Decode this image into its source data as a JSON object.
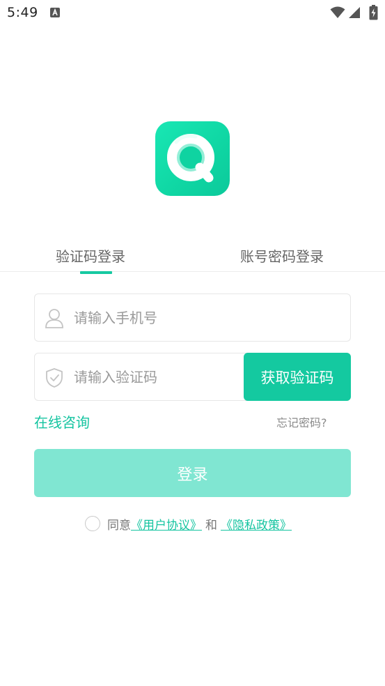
{
  "status_bar": {
    "time": "5:49",
    "notification_icon": "a-notification-icon",
    "wifi_icon": "wifi-icon",
    "signal_icon": "cellular-signal-icon",
    "battery_icon": "battery-charging-icon"
  },
  "logo": {
    "icon": "app-logo-q"
  },
  "tabs": [
    {
      "label": "验证码登录",
      "active": true
    },
    {
      "label": "账号密码登录",
      "active": false
    }
  ],
  "phone_field": {
    "placeholder": "请输入手机号",
    "icon": "user-icon"
  },
  "code_field": {
    "placeholder": "请输入验证码",
    "icon": "shield-check-icon"
  },
  "get_code_button": {
    "label": "获取验证码"
  },
  "consult_link": {
    "label": "在线咨询"
  },
  "forgot_link": {
    "label": "忘记密码?"
  },
  "login_button": {
    "label": "登录"
  },
  "agreement": {
    "prefix": "同意",
    "user_agreement": "《用户协议》",
    "and": "和",
    "privacy_policy": "《隐私政策》",
    "checked": false
  },
  "colors": {
    "accent": "#14c9a0",
    "login_disabled": "#80e6d2",
    "link": "#14c4a0"
  }
}
